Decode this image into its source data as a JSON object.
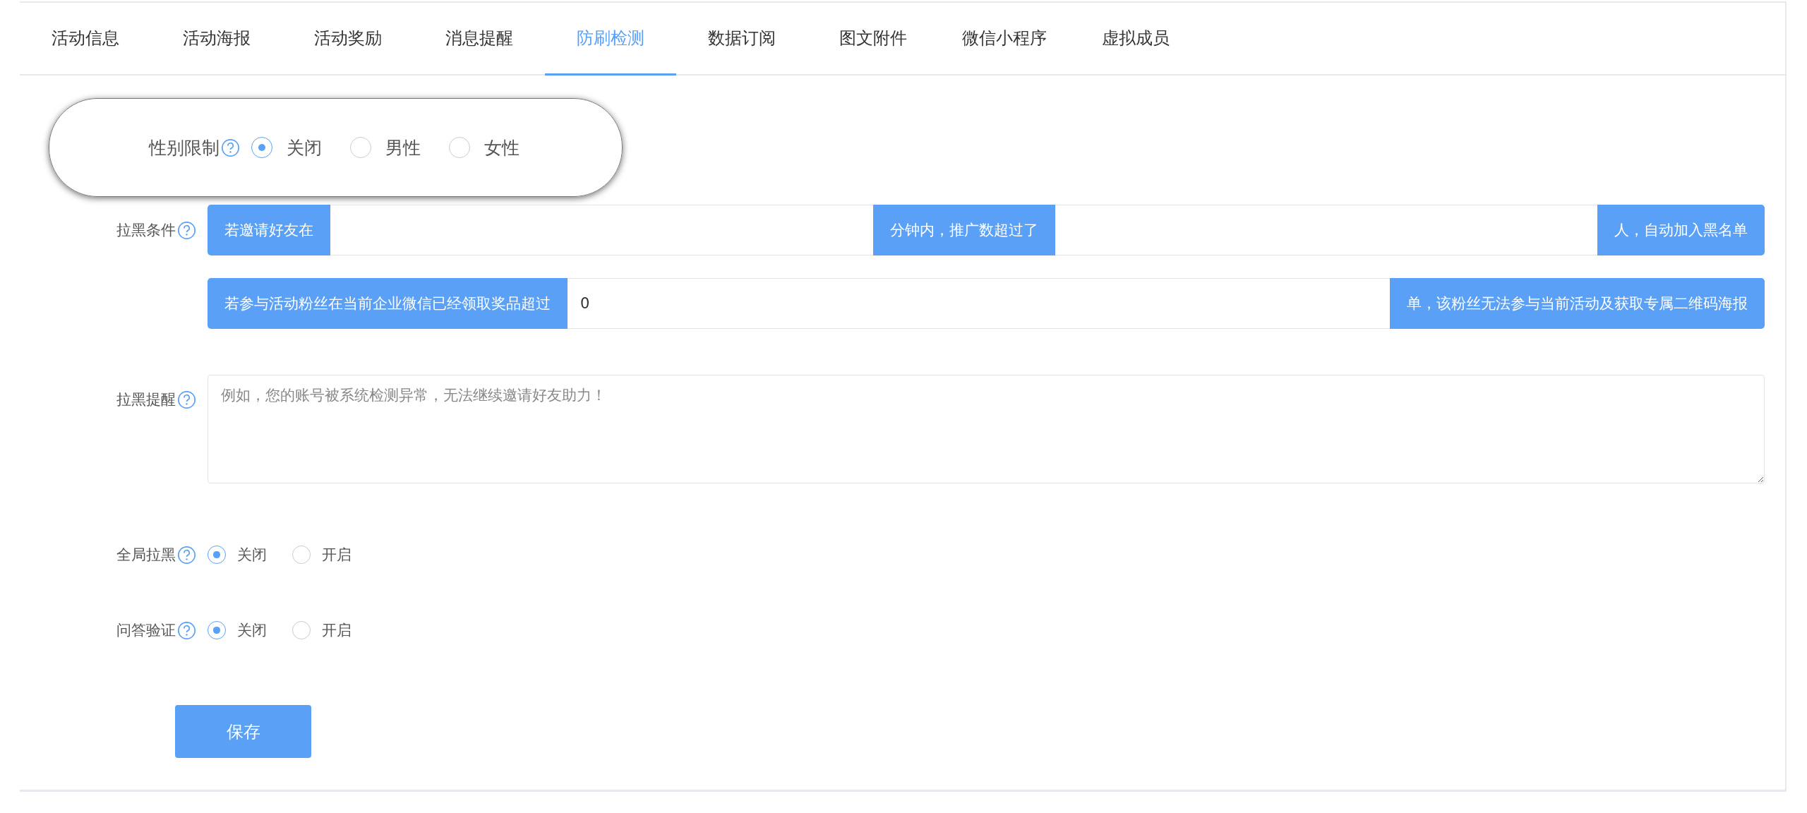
{
  "tabs": [
    {
      "label": "活动信息",
      "selected": false
    },
    {
      "label": "活动海报",
      "selected": false
    },
    {
      "label": "活动奖励",
      "selected": false
    },
    {
      "label": "消息提醒",
      "selected": false
    },
    {
      "label": "防刷检测",
      "selected": true
    },
    {
      "label": "数据订阅",
      "selected": false
    },
    {
      "label": "图文附件",
      "selected": false
    },
    {
      "label": "微信小程序",
      "selected": false
    },
    {
      "label": "虚拟成员",
      "selected": false
    }
  ],
  "gender_limit": {
    "label": "性别限制",
    "emphasized": true,
    "options": [
      {
        "label": "关闭",
        "selected": true
      },
      {
        "label": "男性",
        "selected": false
      },
      {
        "label": "女性",
        "selected": false
      }
    ]
  },
  "blacklist_conditions": {
    "label": "拉黑条件",
    "groups": [
      {
        "segments": [
          {
            "kind": "addon",
            "text": "若邀请好友在"
          },
          {
            "kind": "input"
          },
          {
            "kind": "addon",
            "text": "分钟内，推广数超过了"
          },
          {
            "kind": "input"
          },
          {
            "kind": "addon",
            "text": "人，自动加入黑名单"
          }
        ]
      },
      {
        "segments": [
          {
            "kind": "addon",
            "text": "若参与活动粉丝在当前企业微信已经领取奖品超过"
          },
          {
            "kind": "input",
            "value": "0"
          },
          {
            "kind": "addon",
            "text": "单，该粉丝无法参与当前活动及获取专属二维码海报"
          }
        ]
      }
    ]
  },
  "blacklist_reminder": {
    "label": "拉黑提醒",
    "placeholder": "例如，您的账号被系统检测异常，无法继续邀请好友助力！"
  },
  "global_blacklist": {
    "label": "全局拉黑",
    "options": [
      {
        "label": "关闭",
        "selected": true
      },
      {
        "label": "开启",
        "selected": false
      }
    ]
  },
  "qa_verification": {
    "label": "问答验证",
    "options": [
      {
        "label": "关闭",
        "selected": true
      },
      {
        "label": "开启",
        "selected": false
      }
    ]
  },
  "save_button": "保存"
}
